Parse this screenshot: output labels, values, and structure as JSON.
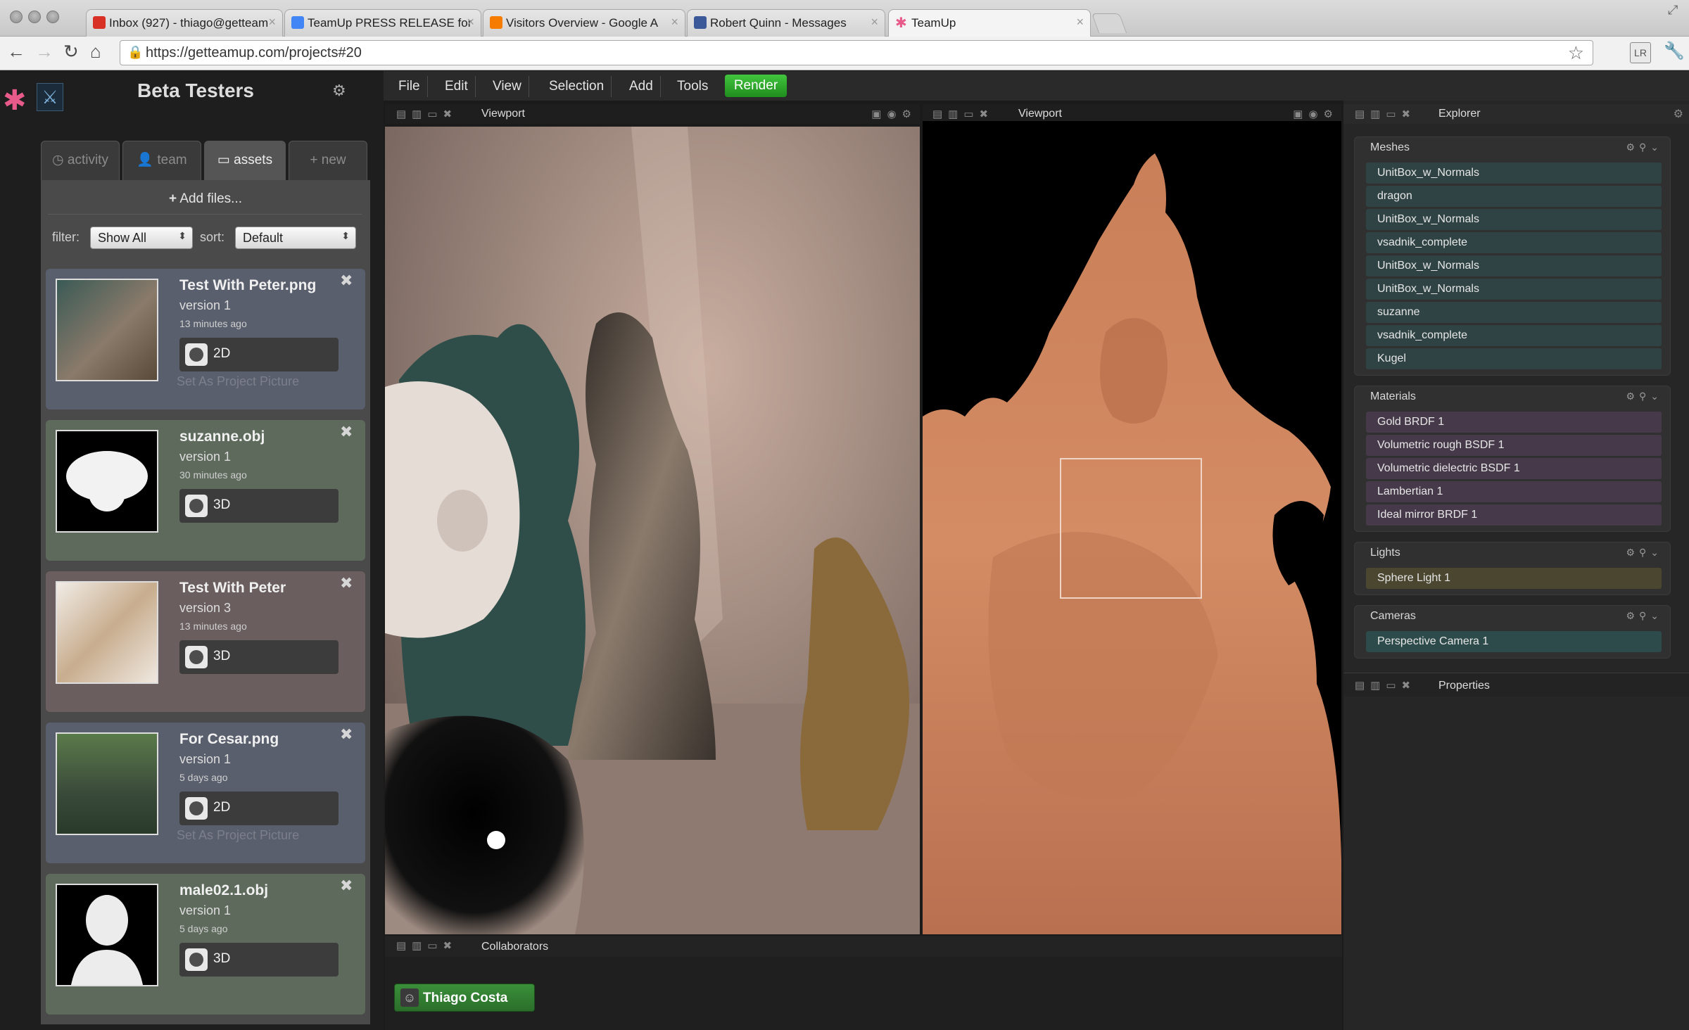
{
  "browser": {
    "tabs": [
      {
        "title": "Inbox (927) - thiago@getteam",
        "icon": "gmail-icon",
        "color": "#d93025"
      },
      {
        "title": "TeamUp PRESS RELEASE for",
        "icon": "docs-icon",
        "color": "#4285f4"
      },
      {
        "title": "Visitors Overview - Google A",
        "icon": "analytics-icon",
        "color": "#f57c00"
      },
      {
        "title": "Robert Quinn - Messages",
        "icon": "facebook-icon",
        "color": "#3b5998"
      },
      {
        "title": "TeamUp",
        "icon": "teamup-icon",
        "color": "#e85a8a"
      }
    ],
    "url": "https://getteamup.com/projects#20"
  },
  "app": {
    "project_title": "Beta Testers",
    "menu": [
      "File",
      "Edit",
      "View",
      "Selection",
      "Add",
      "Tools"
    ],
    "render_label": "Render",
    "accent": "#2e9e2a"
  },
  "sidebar": {
    "tabs": [
      {
        "label": "activity",
        "icon": "clock-icon"
      },
      {
        "label": "team",
        "icon": "person-icon"
      },
      {
        "label": "assets",
        "icon": "folder-icon",
        "active": true
      },
      {
        "label": "new",
        "icon": "plus-icon"
      }
    ],
    "add_files": "Add files...",
    "filter_label": "filter:",
    "filter_value": "Show All",
    "sort_label": "sort:",
    "sort_value": "Default",
    "assets": [
      {
        "name": "Test With Peter.png",
        "version": "version 1",
        "time": "13 minutes ago",
        "badge": "2D",
        "action": "Set As Project Picture"
      },
      {
        "name": "suzanne.obj",
        "version": "version 1",
        "time": "30 minutes ago",
        "badge": "3D"
      },
      {
        "name": "Test With Peter",
        "version": "version 3",
        "time": "13 minutes ago",
        "badge": "3D"
      },
      {
        "name": "For Cesar.png",
        "version": "version 1",
        "time": "5 days ago",
        "badge": "2D",
        "action": "Set As Project Picture"
      },
      {
        "name": "male02.1.obj",
        "version": "version 1",
        "time": "5 days ago",
        "badge": "3D"
      }
    ]
  },
  "viewports": {
    "left_title": "Viewport",
    "right_title": "Viewport"
  },
  "collaborators": {
    "title": "Collaborators",
    "users": [
      "Thiago Costa"
    ]
  },
  "explorer": {
    "title": "Explorer",
    "groups": {
      "meshes": {
        "title": "Meshes",
        "items": [
          "UnitBox_w_Normals",
          "dragon",
          "UnitBox_w_Normals",
          "vsadnik_complete",
          "UnitBox_w_Normals",
          "UnitBox_w_Normals",
          "suzanne",
          "vsadnik_complete",
          "Kugel"
        ]
      },
      "materials": {
        "title": "Materials",
        "items": [
          "Gold BRDF 1",
          "Volumetric rough BSDF 1",
          "Volumetric dielectric BSDF 1",
          "Lambertian 1",
          "Ideal mirror BRDF 1"
        ]
      },
      "lights": {
        "title": "Lights",
        "items": [
          "Sphere Light 1"
        ]
      },
      "cameras": {
        "title": "Cameras",
        "items": [
          "Perspective Camera 1"
        ]
      }
    },
    "properties_title": "Properties"
  }
}
